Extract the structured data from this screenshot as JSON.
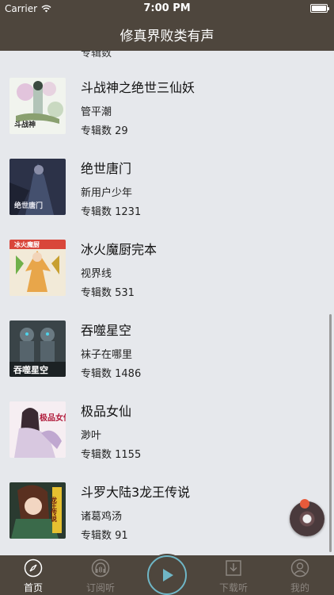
{
  "status_bar": {
    "carrier": "Carrier",
    "time": "7:00 PM"
  },
  "nav": {
    "title": "修真界败类有声"
  },
  "partial_item": {
    "albums": "专辑数"
  },
  "items": [
    {
      "title": "斗战神之绝世三仙妖",
      "author": "管平潮",
      "albums": "专辑数 29",
      "cover_text": "斗战神"
    },
    {
      "title": "绝世唐门",
      "author": "新用户少年",
      "albums": "专辑数 1231",
      "cover_text": "绝世唐门"
    },
    {
      "title": "冰火魔厨完本",
      "author": "视界线",
      "albums": "专辑数 531",
      "cover_text": "冰火魔厨"
    },
    {
      "title": "吞噬星空",
      "author": "袜子在哪里",
      "albums": "专辑数 1486",
      "cover_text": "吞噬星空"
    },
    {
      "title": "极品女仙",
      "author": "渺叶",
      "albums": "专辑数 1155",
      "cover_text": "极品女仙"
    },
    {
      "title": "斗罗大陆3龙王传说",
      "author": "诸葛鸡汤",
      "albums": "专辑数 91",
      "cover_text": "龙王传说"
    }
  ],
  "tabs": [
    {
      "label": "首页",
      "icon": "compass-icon",
      "active": true
    },
    {
      "label": "订阅听",
      "icon": "headphones-icon",
      "active": false
    },
    {
      "label": "下载听",
      "icon": "download-icon",
      "active": false
    },
    {
      "label": "我的",
      "icon": "user-icon",
      "active": false
    }
  ],
  "colors": {
    "bar": "#4e463d",
    "background": "#e6e8ec",
    "accent": "#6fb6c6"
  }
}
